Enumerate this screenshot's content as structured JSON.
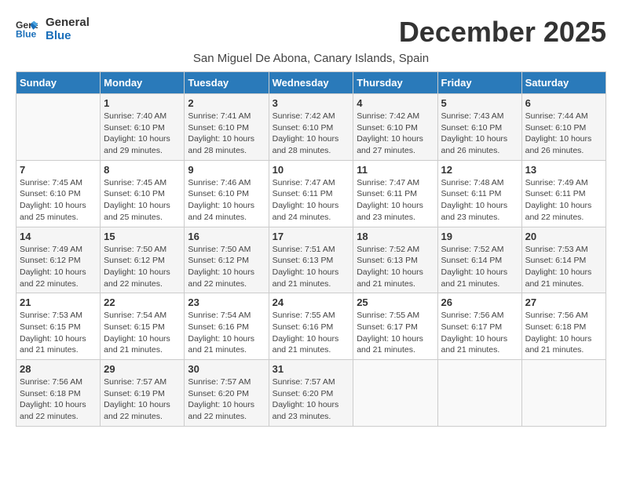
{
  "header": {
    "logo_line1": "General",
    "logo_line2": "Blue",
    "month_title": "December 2025",
    "location": "San Miguel De Abona, Canary Islands, Spain"
  },
  "weekdays": [
    "Sunday",
    "Monday",
    "Tuesday",
    "Wednesday",
    "Thursday",
    "Friday",
    "Saturday"
  ],
  "weeks": [
    [
      {
        "day": "",
        "info": ""
      },
      {
        "day": "1",
        "info": "Sunrise: 7:40 AM\nSunset: 6:10 PM\nDaylight: 10 hours\nand 29 minutes."
      },
      {
        "day": "2",
        "info": "Sunrise: 7:41 AM\nSunset: 6:10 PM\nDaylight: 10 hours\nand 28 minutes."
      },
      {
        "day": "3",
        "info": "Sunrise: 7:42 AM\nSunset: 6:10 PM\nDaylight: 10 hours\nand 28 minutes."
      },
      {
        "day": "4",
        "info": "Sunrise: 7:42 AM\nSunset: 6:10 PM\nDaylight: 10 hours\nand 27 minutes."
      },
      {
        "day": "5",
        "info": "Sunrise: 7:43 AM\nSunset: 6:10 PM\nDaylight: 10 hours\nand 26 minutes."
      },
      {
        "day": "6",
        "info": "Sunrise: 7:44 AM\nSunset: 6:10 PM\nDaylight: 10 hours\nand 26 minutes."
      }
    ],
    [
      {
        "day": "7",
        "info": "Sunrise: 7:45 AM\nSunset: 6:10 PM\nDaylight: 10 hours\nand 25 minutes."
      },
      {
        "day": "8",
        "info": "Sunrise: 7:45 AM\nSunset: 6:10 PM\nDaylight: 10 hours\nand 25 minutes."
      },
      {
        "day": "9",
        "info": "Sunrise: 7:46 AM\nSunset: 6:10 PM\nDaylight: 10 hours\nand 24 minutes."
      },
      {
        "day": "10",
        "info": "Sunrise: 7:47 AM\nSunset: 6:11 PM\nDaylight: 10 hours\nand 24 minutes."
      },
      {
        "day": "11",
        "info": "Sunrise: 7:47 AM\nSunset: 6:11 PM\nDaylight: 10 hours\nand 23 minutes."
      },
      {
        "day": "12",
        "info": "Sunrise: 7:48 AM\nSunset: 6:11 PM\nDaylight: 10 hours\nand 23 minutes."
      },
      {
        "day": "13",
        "info": "Sunrise: 7:49 AM\nSunset: 6:11 PM\nDaylight: 10 hours\nand 22 minutes."
      }
    ],
    [
      {
        "day": "14",
        "info": "Sunrise: 7:49 AM\nSunset: 6:12 PM\nDaylight: 10 hours\nand 22 minutes."
      },
      {
        "day": "15",
        "info": "Sunrise: 7:50 AM\nSunset: 6:12 PM\nDaylight: 10 hours\nand 22 minutes."
      },
      {
        "day": "16",
        "info": "Sunrise: 7:50 AM\nSunset: 6:12 PM\nDaylight: 10 hours\nand 22 minutes."
      },
      {
        "day": "17",
        "info": "Sunrise: 7:51 AM\nSunset: 6:13 PM\nDaylight: 10 hours\nand 21 minutes."
      },
      {
        "day": "18",
        "info": "Sunrise: 7:52 AM\nSunset: 6:13 PM\nDaylight: 10 hours\nand 21 minutes."
      },
      {
        "day": "19",
        "info": "Sunrise: 7:52 AM\nSunset: 6:14 PM\nDaylight: 10 hours\nand 21 minutes."
      },
      {
        "day": "20",
        "info": "Sunrise: 7:53 AM\nSunset: 6:14 PM\nDaylight: 10 hours\nand 21 minutes."
      }
    ],
    [
      {
        "day": "21",
        "info": "Sunrise: 7:53 AM\nSunset: 6:15 PM\nDaylight: 10 hours\nand 21 minutes."
      },
      {
        "day": "22",
        "info": "Sunrise: 7:54 AM\nSunset: 6:15 PM\nDaylight: 10 hours\nand 21 minutes."
      },
      {
        "day": "23",
        "info": "Sunrise: 7:54 AM\nSunset: 6:16 PM\nDaylight: 10 hours\nand 21 minutes."
      },
      {
        "day": "24",
        "info": "Sunrise: 7:55 AM\nSunset: 6:16 PM\nDaylight: 10 hours\nand 21 minutes."
      },
      {
        "day": "25",
        "info": "Sunrise: 7:55 AM\nSunset: 6:17 PM\nDaylight: 10 hours\nand 21 minutes."
      },
      {
        "day": "26",
        "info": "Sunrise: 7:56 AM\nSunset: 6:17 PM\nDaylight: 10 hours\nand 21 minutes."
      },
      {
        "day": "27",
        "info": "Sunrise: 7:56 AM\nSunset: 6:18 PM\nDaylight: 10 hours\nand 21 minutes."
      }
    ],
    [
      {
        "day": "28",
        "info": "Sunrise: 7:56 AM\nSunset: 6:18 PM\nDaylight: 10 hours\nand 22 minutes."
      },
      {
        "day": "29",
        "info": "Sunrise: 7:57 AM\nSunset: 6:19 PM\nDaylight: 10 hours\nand 22 minutes."
      },
      {
        "day": "30",
        "info": "Sunrise: 7:57 AM\nSunset: 6:20 PM\nDaylight: 10 hours\nand 22 minutes."
      },
      {
        "day": "31",
        "info": "Sunrise: 7:57 AM\nSunset: 6:20 PM\nDaylight: 10 hours\nand 23 minutes."
      },
      {
        "day": "",
        "info": ""
      },
      {
        "day": "",
        "info": ""
      },
      {
        "day": "",
        "info": ""
      }
    ]
  ]
}
